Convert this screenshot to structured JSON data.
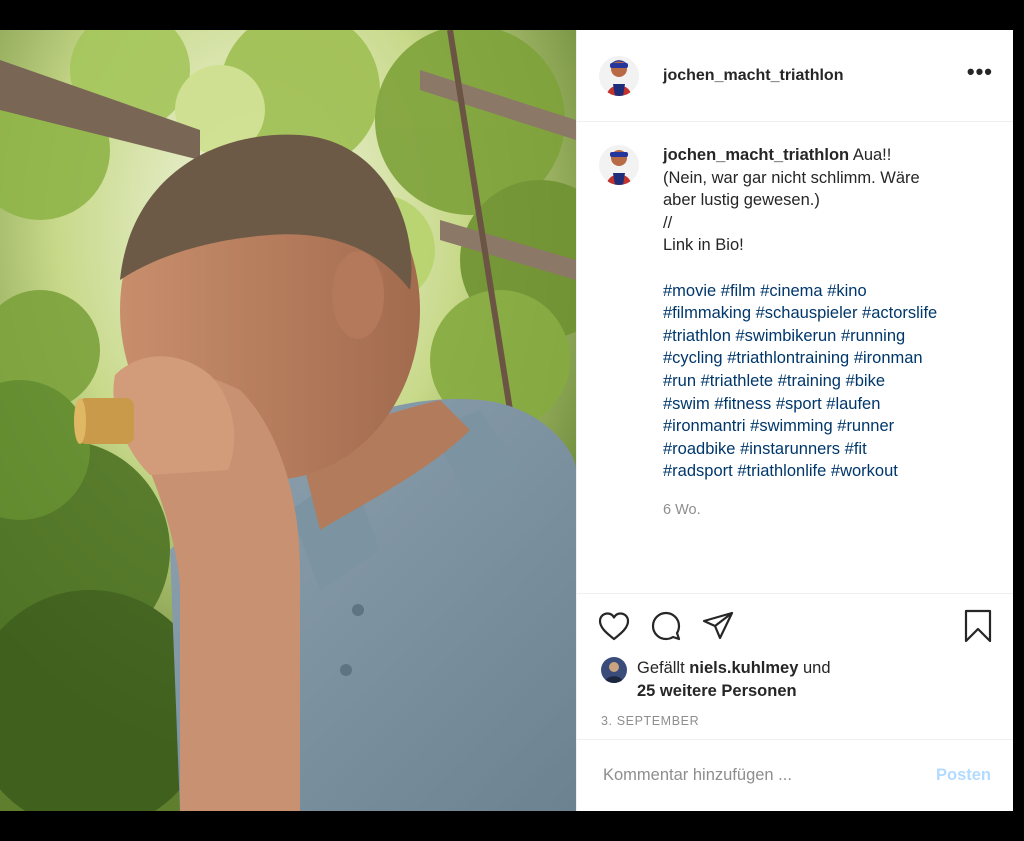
{
  "post": {
    "username": "jochen_macht_triathlon",
    "more_label": "•••",
    "caption_lines": [
      "Aua!!",
      "(Nein, war gar nicht schlimm. Wäre",
      "aber lustig gewesen.)",
      "//",
      "Link in Bio!"
    ],
    "hashtag_lines": [
      [
        "#movie",
        "#film",
        "#cinema",
        "#kino"
      ],
      [
        "#filmmaking",
        "#schauspieler",
        "#actorslife"
      ],
      [
        "#triathlon",
        "#swimbikerun",
        "#running"
      ],
      [
        "#cycling",
        "#triathlontraining",
        "#ironman"
      ],
      [
        "#run",
        "#triathlete",
        "#training",
        "#bike"
      ],
      [
        "#swim",
        "#fitness",
        "#sport",
        "#laufen"
      ],
      [
        "#ironmantri",
        "#swimming",
        "#runner"
      ],
      [
        "#roadbike",
        "#instarunners",
        "#fit"
      ],
      [
        "#radsport",
        "#triathlonlife",
        "#workout"
      ]
    ],
    "age": "6 Wo.",
    "likes": {
      "prefix": "Gefällt ",
      "user": "niels.kuhlmey",
      "suffix": " und",
      "others": "25 weitere Personen"
    },
    "date": "3. SEPTEMBER",
    "comment": {
      "placeholder": "Kommentar hinzufügen ...",
      "value": "",
      "post_label": "Posten"
    }
  },
  "icons": {
    "like": "heart-icon",
    "comment": "comment-icon",
    "share": "paper-plane-icon",
    "save": "bookmark-icon"
  },
  "colors": {
    "hashtag": "#00376b",
    "muted": "#8e8e8e",
    "post_button_disabled": "#b3dbff"
  }
}
